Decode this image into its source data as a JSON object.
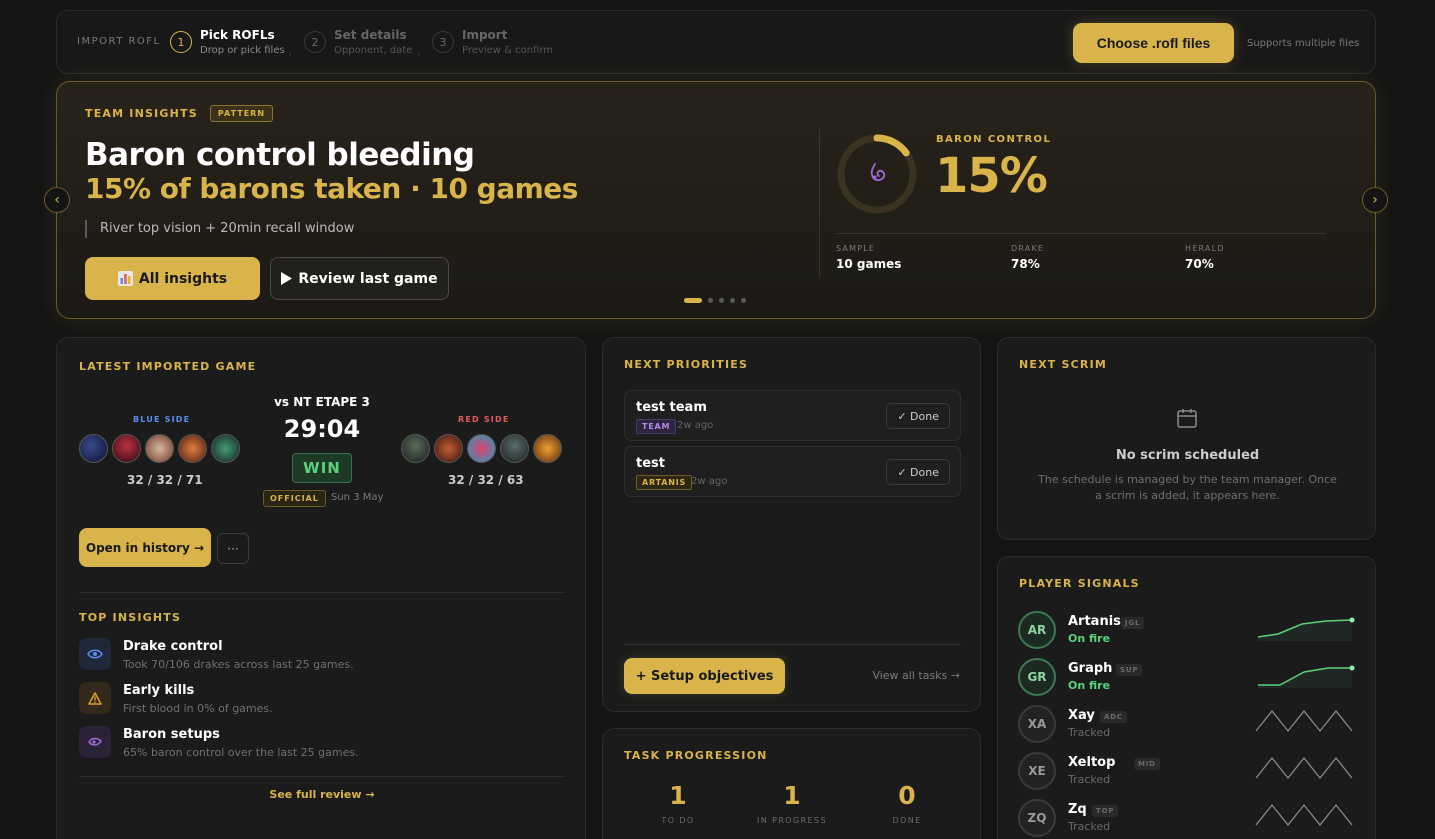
{
  "topbar": {
    "import_label": "IMPORT ROFL",
    "steps": [
      {
        "num": "1",
        "title": "Pick ROFLs",
        "sub": "Drop or pick files"
      },
      {
        "num": "2",
        "title": "Set details",
        "sub": "Opponent, date"
      },
      {
        "num": "3",
        "title": "Import",
        "sub": "Preview & confirm"
      }
    ],
    "choose_label": "Choose .rofl files",
    "supports": "Supports multiple files"
  },
  "hero": {
    "section": "TEAM INSIGHTS",
    "badge": "PATTERN",
    "title": "Baron control bleeding",
    "subtitle": "15% of barons taken · 10 games",
    "note": "River top vision + 20min recall window",
    "all_insights": "All insights",
    "review_last": "Review last game",
    "metric_label": "BARON CONTROL",
    "metric_value": "15%",
    "metric_fraction": 0.15,
    "stats": [
      {
        "k": "SAMPLE",
        "v": "10 games"
      },
      {
        "k": "DRAKE",
        "v": "78%"
      },
      {
        "k": "HERALD",
        "v": "70%"
      }
    ],
    "prev_icon": "‹",
    "next_icon": "›",
    "carousel_pages": 5,
    "carousel_active": 0
  },
  "latest": {
    "title": "LATEST IMPORTED GAME",
    "blue_label": "BLUE SIDE",
    "red_label": "RED SIDE",
    "blue_kda": "32 / 32 / 71",
    "red_kda": "32 / 32 / 63",
    "vs": "vs NT ETAPE 3",
    "duration": "29:04",
    "result": "WIN",
    "official": "OFFICIAL",
    "date": "Sun 3 May",
    "open_history": "Open in history →",
    "more": "···",
    "top_insights_title": "TOP INSIGHTS",
    "insights": [
      {
        "title": "Drake control",
        "desc": "Took 70/106 drakes across last 25 games.",
        "icon": "eye-icon"
      },
      {
        "title": "Early kills",
        "desc": "First blood in 0% of games.",
        "icon": "warning-icon"
      },
      {
        "title": "Baron setups",
        "desc": "65% baron control over the last 25 games.",
        "icon": "baron-icon"
      }
    ],
    "see_full_review": "See full review →"
  },
  "priorities": {
    "title": "NEXT PRIORITIES",
    "tasks": [
      {
        "title": "test team",
        "tag": "TEAM",
        "ago": "2w ago",
        "done": "✓ Done"
      },
      {
        "title": "test",
        "tag": "ARTANIS",
        "ago": "2w ago",
        "done": "✓ Done"
      }
    ],
    "setup": "+ Setup objectives",
    "view_all": "View all tasks →"
  },
  "progression": {
    "title": "TASK PROGRESSION",
    "items": [
      {
        "n": "1",
        "l": "TO DO"
      },
      {
        "n": "1",
        "l": "IN PROGRESS"
      },
      {
        "n": "0",
        "l": "DONE"
      }
    ]
  },
  "scrim": {
    "title": "NEXT SCRIM",
    "empty_title": "No scrim scheduled",
    "empty_desc": "The schedule is managed by the team manager. Once a scrim is added, it appears here."
  },
  "signals": {
    "title": "PLAYER SIGNALS",
    "players": [
      {
        "initials": "AR",
        "name": "Artanis",
        "role": "JGL",
        "status": "On fire"
      },
      {
        "initials": "GR",
        "name": "Graph",
        "role": "SUP",
        "status": "On fire"
      },
      {
        "initials": "XA",
        "name": "Xay",
        "role": "ADC",
        "status": "Tracked"
      },
      {
        "initials": "XE",
        "name": "Xeltop",
        "role": "MID",
        "status": "Tracked"
      },
      {
        "initials": "ZQ",
        "name": "Zq",
        "role": "TOP",
        "status": "Tracked"
      }
    ]
  },
  "colors": {
    "accent": "#d9b44a",
    "win": "#5ad27a",
    "blue_side": "#5b8def",
    "red_side": "#e05a5a"
  }
}
